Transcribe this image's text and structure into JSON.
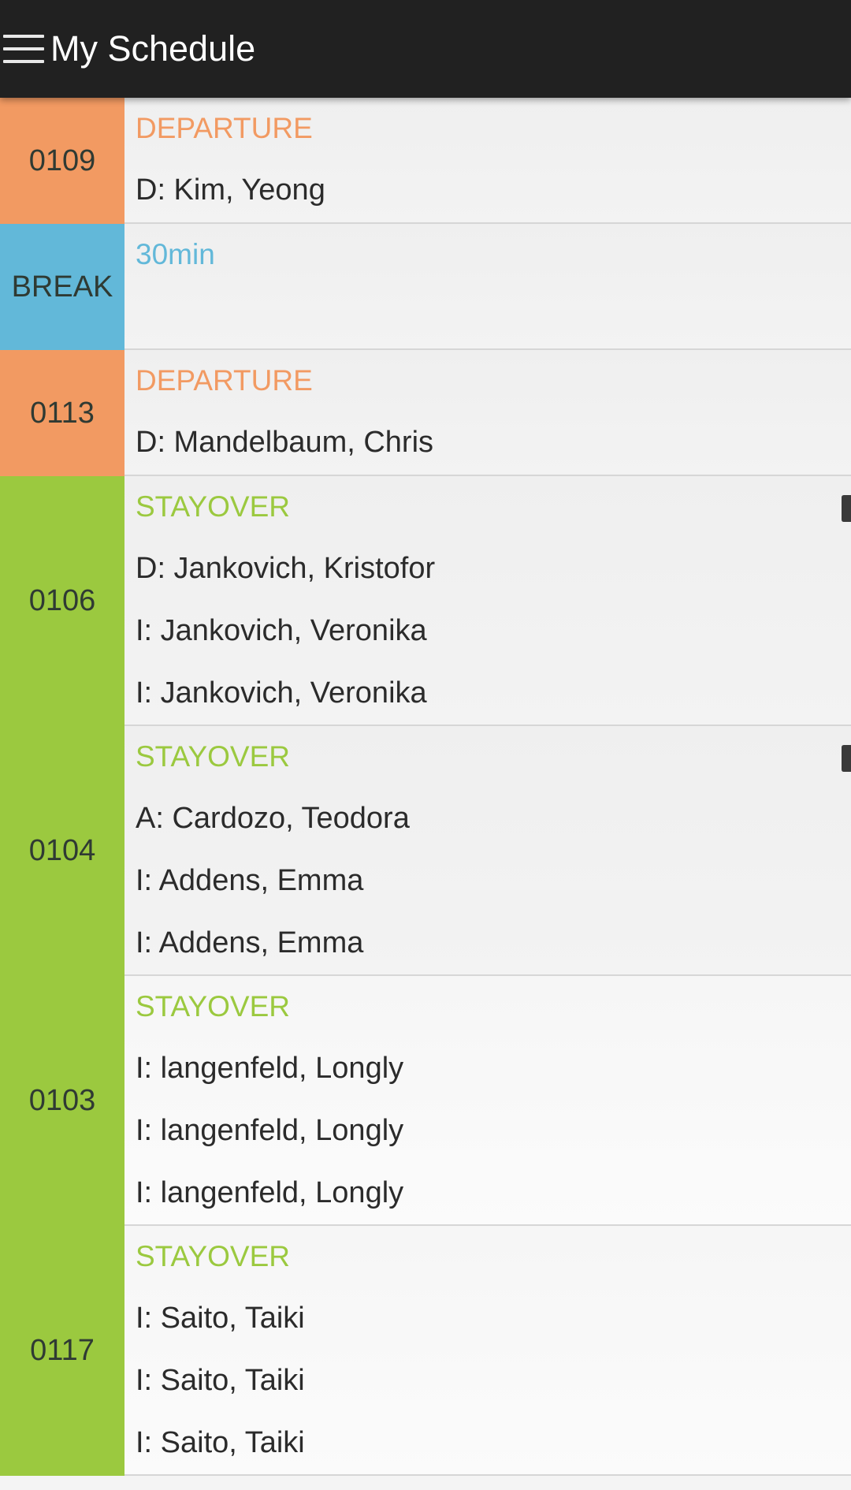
{
  "header": {
    "title": "My Schedule",
    "menu_icon": "hamburger-menu-icon"
  },
  "colors": {
    "departure": "#f29a62",
    "break": "#62b8d9",
    "stayover": "#9bc93f",
    "appbar": "#212121"
  },
  "rows": [
    {
      "room": "0109",
      "type": "departure",
      "status": "DEPARTURE",
      "lines": [
        "D: Kim, Yeong"
      ],
      "has_note": false
    },
    {
      "room": "BREAK",
      "type": "break",
      "status": "30min",
      "lines": [],
      "has_note": false
    },
    {
      "room": "0113",
      "type": "departure",
      "status": "DEPARTURE",
      "lines": [
        "D: Mandelbaum, Chris"
      ],
      "has_note": false
    },
    {
      "room": "0106",
      "type": "stayover",
      "status": "STAYOVER",
      "lines": [
        "D: Jankovich, Kristofor",
        "I: Jankovich, Veronika",
        "I: Jankovich, Veronika"
      ],
      "has_note": true
    },
    {
      "room": "0104",
      "type": "stayover",
      "status": "STAYOVER",
      "lines": [
        "A: Cardozo, Teodora",
        "I: Addens, Emma",
        "I: Addens, Emma"
      ],
      "has_note": true
    },
    {
      "room": "0103",
      "type": "stayover",
      "status": "STAYOVER",
      "lines": [
        "I: langenfeld, Longly",
        "I: langenfeld, Longly",
        "I: langenfeld, Longly"
      ],
      "has_note": false
    },
    {
      "room": "0117",
      "type": "stayover",
      "status": "STAYOVER",
      "lines": [
        "I: Saito, Taiki",
        "I: Saito, Taiki",
        "I: Saito, Taiki"
      ],
      "has_note": false
    }
  ]
}
